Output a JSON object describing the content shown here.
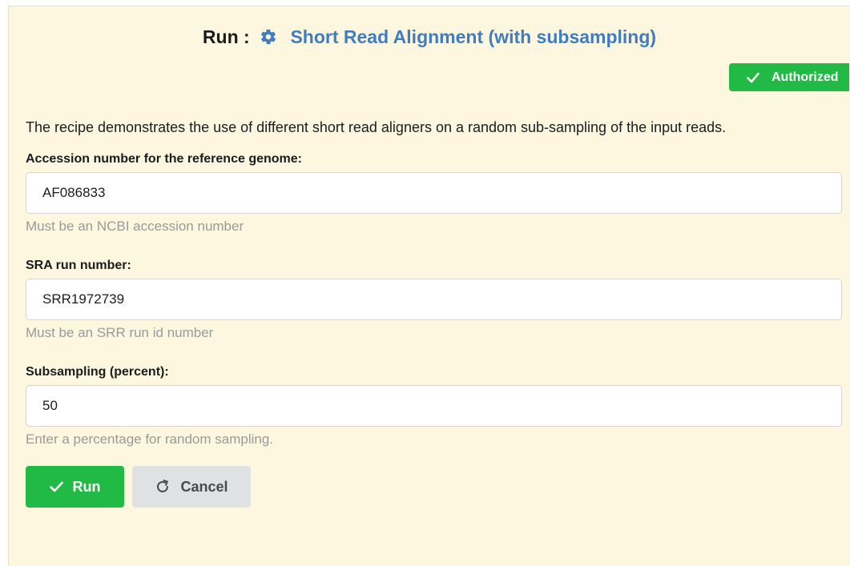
{
  "header": {
    "run_label": "Run :",
    "gear_icon": "gear-icon",
    "recipe_name": "Short Read Alignment (with subsampling)",
    "recipe_color": "#3f7cc0"
  },
  "auth_badge": {
    "label": "Authorized",
    "icon": "checkmark-icon",
    "color": "#21ba45"
  },
  "description": "The recipe demonstrates the use of different short read aligners on a random sub-sampling of the input reads.",
  "fields": [
    {
      "label": "Accession number for the reference genome:",
      "value": "AF086833",
      "hint": "Must be an NCBI accession number"
    },
    {
      "label": "SRA run number:",
      "value": "SRR1972739",
      "hint": "Must be an SRR run id number"
    },
    {
      "label": "Subsampling (percent):",
      "value": "50",
      "hint": "Enter a percentage for random sampling."
    }
  ],
  "actions": {
    "run_label": "Run",
    "run_icon": "checkmark-icon",
    "run_color": "#21ba45",
    "cancel_label": "Cancel",
    "cancel_icon": "redo-icon",
    "cancel_color": "#e0e1e2"
  }
}
